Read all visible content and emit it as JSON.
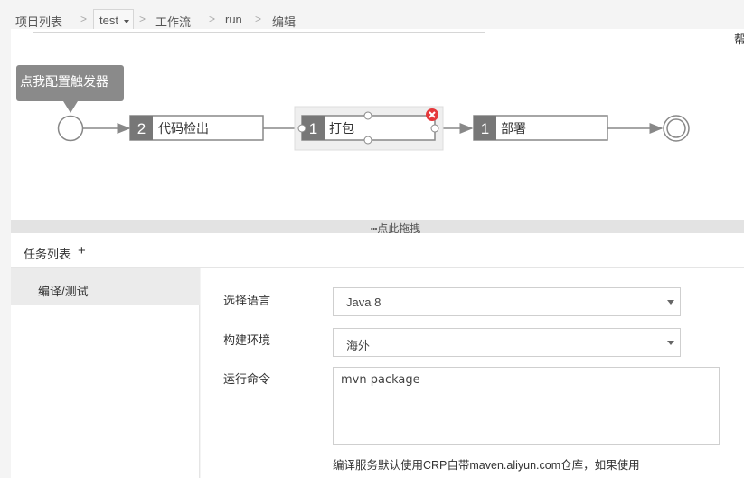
{
  "breadcrumb": {
    "project_list": "项目列表",
    "project": "test",
    "workflow": "工作流",
    "run": "run",
    "edit": "编辑",
    "separator": ">"
  },
  "help_label": "帮",
  "pipeline": {
    "trigger_tooltip": "点我配置触发器",
    "stages": [
      {
        "count": "2",
        "name": "代码检出"
      },
      {
        "count": "1",
        "name": "打包"
      },
      {
        "count": "1",
        "name": "部署"
      }
    ]
  },
  "splitter_label": "点此拖拽",
  "tasks": {
    "title": "任务列表",
    "add": "+",
    "items": [
      {
        "label": "编译/测试"
      }
    ]
  },
  "form": {
    "language_label": "选择语言",
    "language_value": "Java 8",
    "env_label": "构建环境",
    "env_value": "海外",
    "command_label": "运行命令",
    "command_value": "mvn package",
    "hint_line1": "编译服务默认使用CRP自带maven.aliyun.com仓库，如果使用"
  },
  "colors": {
    "stage_fill": "#777777",
    "node_border": "#888888",
    "delete_badge": "#e5383b",
    "tooltip_bg": "#8a8a8a"
  }
}
